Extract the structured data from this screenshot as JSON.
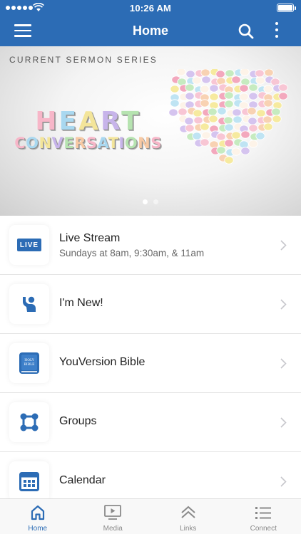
{
  "status_bar": {
    "time": "10:26 AM"
  },
  "nav": {
    "title": "Home"
  },
  "hero": {
    "series_label": "CURRENT SERMON SERIES",
    "art_line1": "HEART",
    "art_line2": "CONVERSATIONS",
    "slides": {
      "count": 2,
      "active": 1
    }
  },
  "menu": [
    {
      "label": "Live Stream",
      "subtitle": "Sundays at 8am, 9:30am, & 11am",
      "badge": "LIVE",
      "icon": "live-badge-icon"
    },
    {
      "label": "I'm New!",
      "icon": "person-wave-icon"
    },
    {
      "label": "YouVersion Bible",
      "icon": "bible-icon",
      "icon_text": "HOLY BIBLE"
    },
    {
      "label": "Groups",
      "icon": "groups-icon"
    },
    {
      "label": "Calendar",
      "icon": "calendar-icon"
    }
  ],
  "tabs": [
    {
      "label": "Home",
      "icon": "home-icon",
      "active": true
    },
    {
      "label": "Media",
      "icon": "media-icon",
      "active": false
    },
    {
      "label": "Links",
      "icon": "links-icon",
      "active": false
    },
    {
      "label": "Connect",
      "icon": "connect-icon",
      "active": false
    }
  ],
  "colors": {
    "brand": "#2c6cb5",
    "tab_inactive": "#8a8a8a",
    "chevron": "#c7c7cc"
  }
}
